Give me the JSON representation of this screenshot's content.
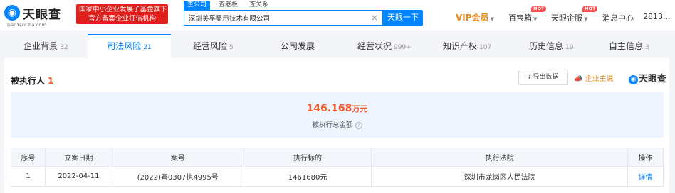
{
  "header": {
    "logo_text": "天眼查",
    "logo_domain": "TianYanCha.com",
    "banner_line1": "国家中小企业发展子基金旗下",
    "banner_line2": "官方备案企业征信机构",
    "search_tabs": [
      "查公司",
      "查老板",
      "查关系"
    ],
    "search_value": "深圳美孚显示技术有限公司",
    "search_button": "天眼一下",
    "nav": {
      "vip": "VIP会员",
      "baibaoxiang": "百宝箱",
      "enterprise": "天眼企服",
      "messages": "消息中心",
      "user": "2813..."
    },
    "hot_badge": "HOT"
  },
  "tabs": [
    {
      "label": "企业背景",
      "count": "32"
    },
    {
      "label": "司法风险",
      "count": "21"
    },
    {
      "label": "经营风险",
      "count": "5"
    },
    {
      "label": "公司发展",
      "count": ""
    },
    {
      "label": "经营状况",
      "count": "999+"
    },
    {
      "label": "知识产权",
      "count": "107"
    },
    {
      "label": "历史信息",
      "count": "19"
    },
    {
      "label": "自主信息",
      "count": "3"
    }
  ],
  "section": {
    "title": "被执行人",
    "count": "1",
    "export_label": "导出数据",
    "pro_label": "企业主说",
    "brand": "天眼查"
  },
  "summary": {
    "amount": "146.168",
    "unit": "万元",
    "label": "被执行总金额"
  },
  "table": {
    "headers": [
      "序号",
      "立案日期",
      "案号",
      "执行标的",
      "执行法院",
      "操作"
    ],
    "rows": [
      [
        "1",
        "2022-04-11",
        "(2022)粤0307执4995号",
        "1461680元",
        "深圳市龙岗区人民法院",
        "详情"
      ]
    ]
  },
  "colors": {
    "brand_blue": "#0084ff",
    "amount_orange": "#f25a29",
    "banner_red": "#e1201c",
    "vip_gold": "#e88a1a"
  }
}
